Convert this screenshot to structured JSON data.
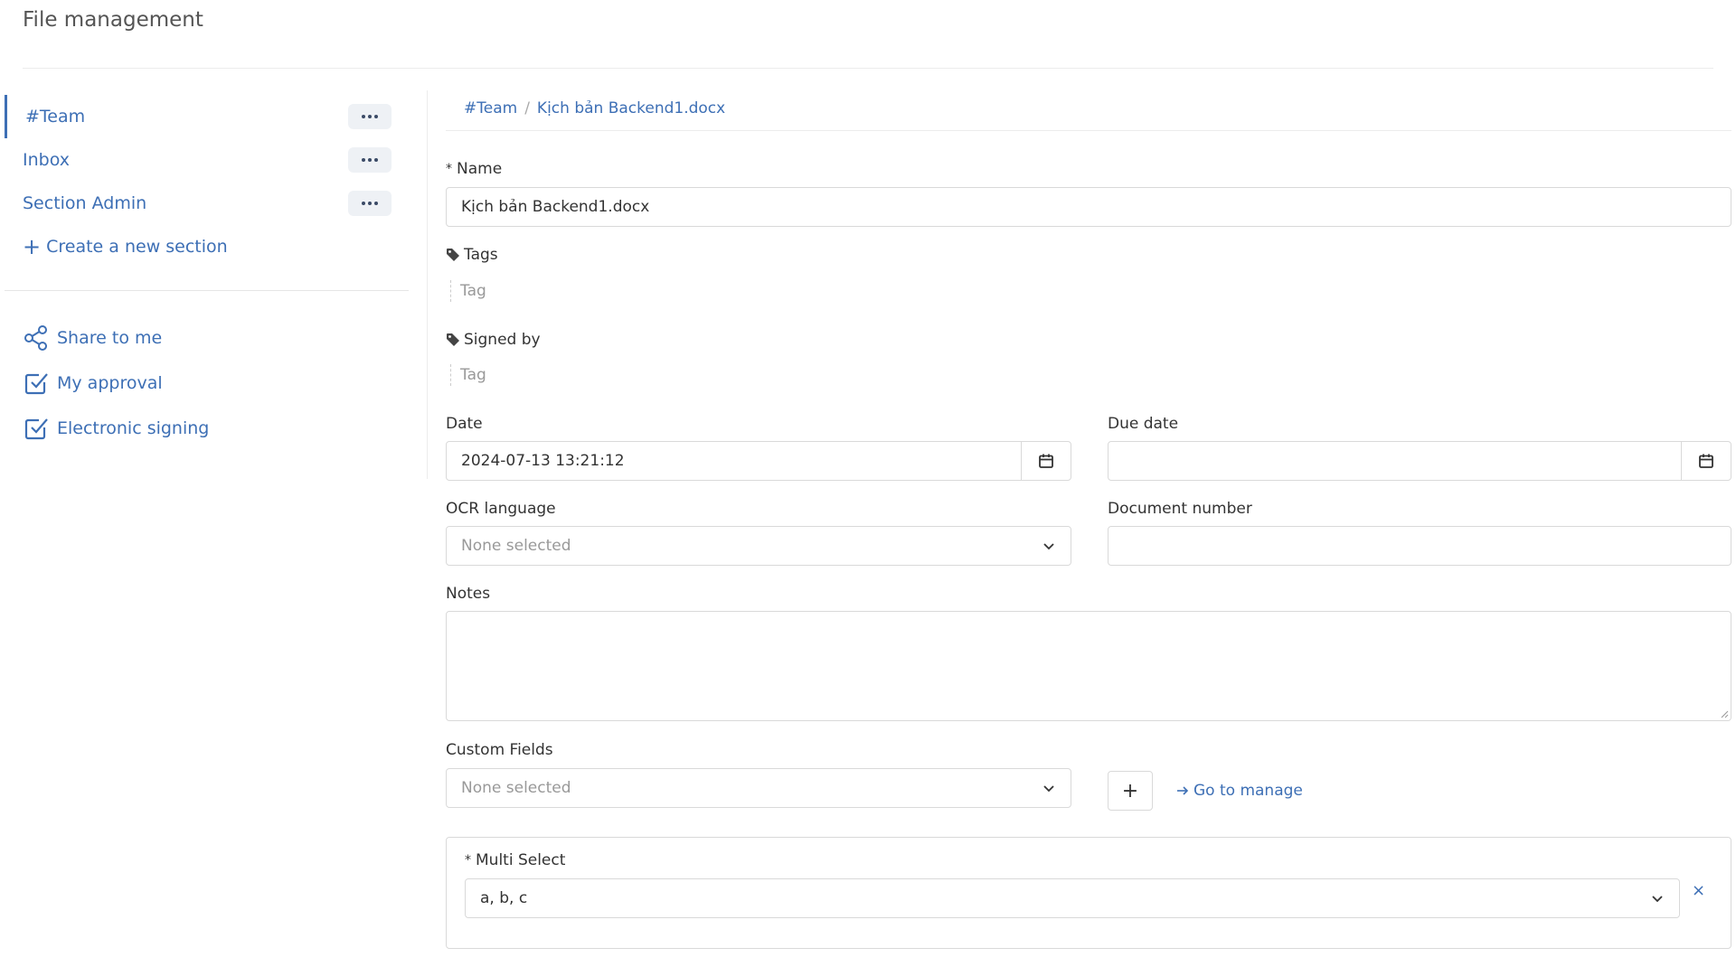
{
  "page": {
    "title": "File management"
  },
  "sidebar": {
    "sections": [
      {
        "label": "#Team",
        "active": true
      },
      {
        "label": "Inbox",
        "active": false
      },
      {
        "label": "Section Admin",
        "active": false
      }
    ],
    "create_label": "Create a new section",
    "links": [
      {
        "label": "Share to me",
        "icon": "share-icon"
      },
      {
        "label": "My approval",
        "icon": "checkbox-icon"
      },
      {
        "label": "Electronic signing",
        "icon": "checkbox-icon"
      }
    ]
  },
  "breadcrumb": {
    "root": "#Team",
    "separator": "/",
    "current": "Kịch bản Backend1.docx"
  },
  "form": {
    "name": {
      "label": "Name",
      "required_mark": "*",
      "value": "Kịch bản Backend1.docx"
    },
    "tags": {
      "label": "Tags",
      "placeholder": "Tag"
    },
    "signed_by": {
      "label": "Signed by",
      "placeholder": "Tag"
    },
    "date": {
      "label": "Date",
      "value": "2024-07-13 13:21:12"
    },
    "due_date": {
      "label": "Due date",
      "value": ""
    },
    "ocr_language": {
      "label": "OCR language",
      "placeholder": "None selected"
    },
    "document_number": {
      "label": "Document number",
      "value": ""
    },
    "notes": {
      "label": "Notes",
      "value": ""
    },
    "custom_fields": {
      "label": "Custom Fields",
      "placeholder": "None selected",
      "add_label": "+",
      "manage_label": "Go to manage"
    },
    "multi_select": {
      "label": "Multi Select",
      "required_mark": "*",
      "value": "a, b, c",
      "remove_label": "×"
    }
  },
  "colors": {
    "accent": "#3d6fb5",
    "border": "#d9d9d9",
    "placeholder": "#999999"
  }
}
